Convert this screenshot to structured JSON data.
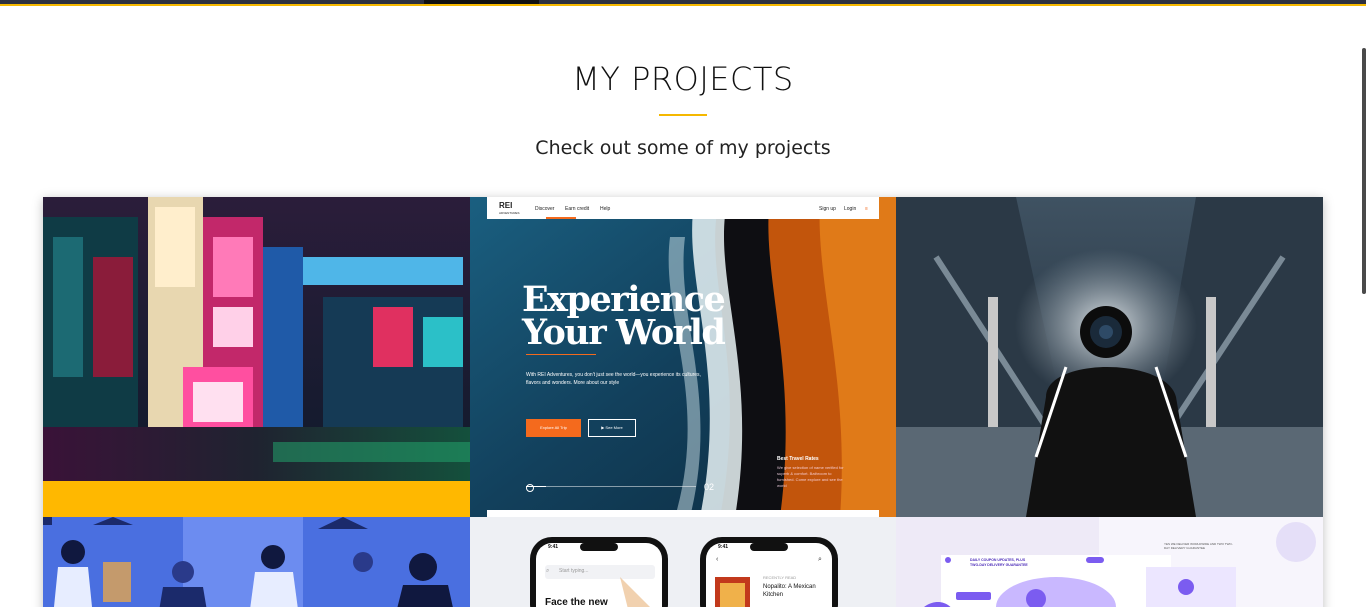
{
  "section": {
    "title": "MY PROJECTS",
    "subtitle": "Check out some of my projects"
  },
  "colors": {
    "accent": "#f5b800",
    "header_dark": "#2e3140",
    "rei_orange": "#f46a1d"
  },
  "projects": [
    {
      "name": "Tokyo neon street night photo"
    },
    {
      "name": "REI Adventures landing page",
      "logo": "REI",
      "logo_sub": "ADVENTURES",
      "nav": [
        "Discover",
        "Earn credit",
        "Help"
      ],
      "nav_right": [
        "Sign up",
        "Login"
      ],
      "hero_title": "Experience Your World",
      "hero_text": "With REI Adventures, you don't just see the world—you experience its cultures, flavors and wonders. More about our style",
      "primary_cta": "Explore All Trip",
      "secondary_cta": "▶  See More",
      "side_title": "Best Travel Rates",
      "side_text": "We give selection of name verified for superb & comfort. Bathroom to furnished. Come explore and see the world",
      "slide_number": "02"
    },
    {
      "name": "Photographer with camera and smoke on escalator"
    },
    {
      "name": "Blue office illustration"
    },
    {
      "name": "Mobile reading app mockup",
      "time_left": "9:41",
      "time_right": "9:41",
      "search_placeholder": "Start typing...",
      "headline": "Face the new",
      "recently_read": "RECENTLY READ",
      "book_title": "Nopalito: A Mexican Kitchen"
    },
    {
      "name": "Delivery service landing page",
      "headline": "DAILY COUPON UPDATES, PLUS TWO-DAY DELIVERY GUARANTEE",
      "tagline": "YES WE DELIVER WORLDWIDE AND TWO TWO-DAY DELIVERY GUARANTEE"
    }
  ]
}
